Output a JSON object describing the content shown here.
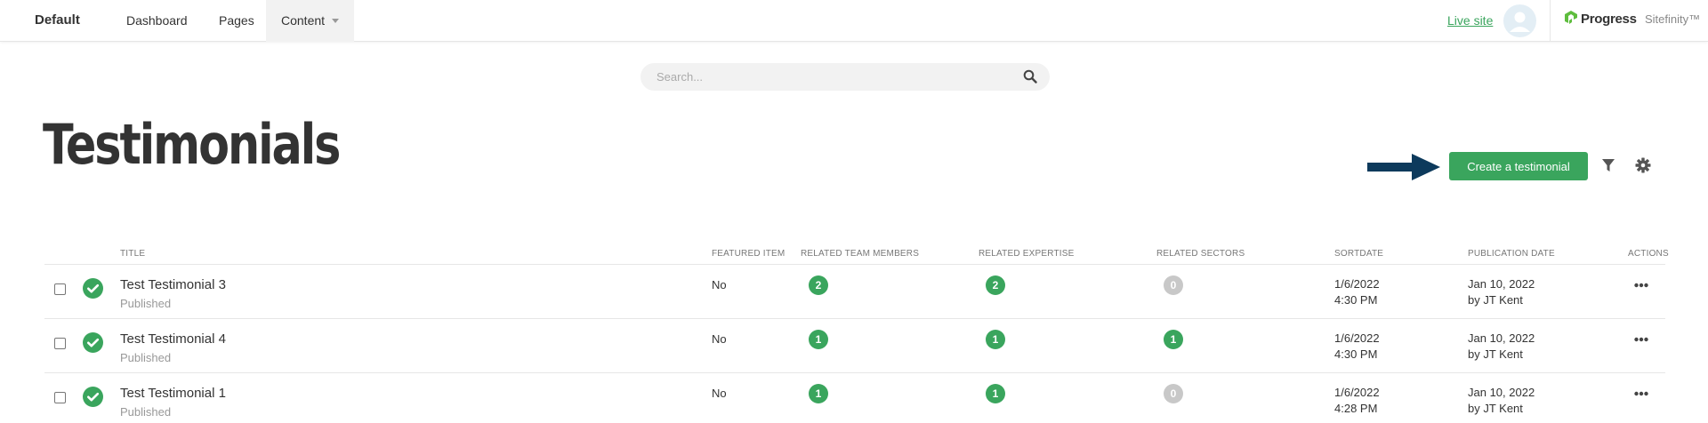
{
  "nav": {
    "brand": "Default",
    "links": {
      "dashboard": "Dashboard",
      "pages": "Pages",
      "content": "Content"
    },
    "live_site": "Live site",
    "logo": {
      "name": "Progress",
      "sub": "Sitefinity™"
    }
  },
  "search": {
    "placeholder": "Search..."
  },
  "page": {
    "title": "Testimonials",
    "create_button": "Create a testimonial"
  },
  "table": {
    "headers": {
      "title": "TITLE",
      "featured": "FEATURED ITEM",
      "team": "RELATED TEAM MEMBERS",
      "expertise": "RELATED EXPERTISE",
      "sectors": "RELATED SECTORS",
      "sortdate": "SORTDATE",
      "pubdate": "PUBLICATION DATE",
      "actions": "ACTIONS"
    },
    "rows": [
      {
        "title": "Test Testimonial 3",
        "status": "Published",
        "featured": "No",
        "team": "2",
        "expertise": "2",
        "sectors": "0",
        "sort_date": "1/6/2022",
        "sort_time": "4:30 PM",
        "pub_date": "Jan 10, 2022",
        "pub_by": "by JT Kent"
      },
      {
        "title": "Test Testimonial 4",
        "status": "Published",
        "featured": "No",
        "team": "1",
        "expertise": "1",
        "sectors": "1",
        "sort_date": "1/6/2022",
        "sort_time": "4:30 PM",
        "pub_date": "Jan 10, 2022",
        "pub_by": "by JT Kent"
      },
      {
        "title": "Test Testimonial 1",
        "status": "Published",
        "featured": "No",
        "team": "1",
        "expertise": "1",
        "sectors": "0",
        "sort_date": "1/6/2022",
        "sort_time": "4:28 PM",
        "pub_date": "Jan 10, 2022",
        "pub_by": "by JT Kent"
      }
    ]
  },
  "colors": {
    "accent": "#3aa55d",
    "badge_zero": "#c8c8c8",
    "arrow": "#0d3a5c",
    "text": "#333333"
  }
}
